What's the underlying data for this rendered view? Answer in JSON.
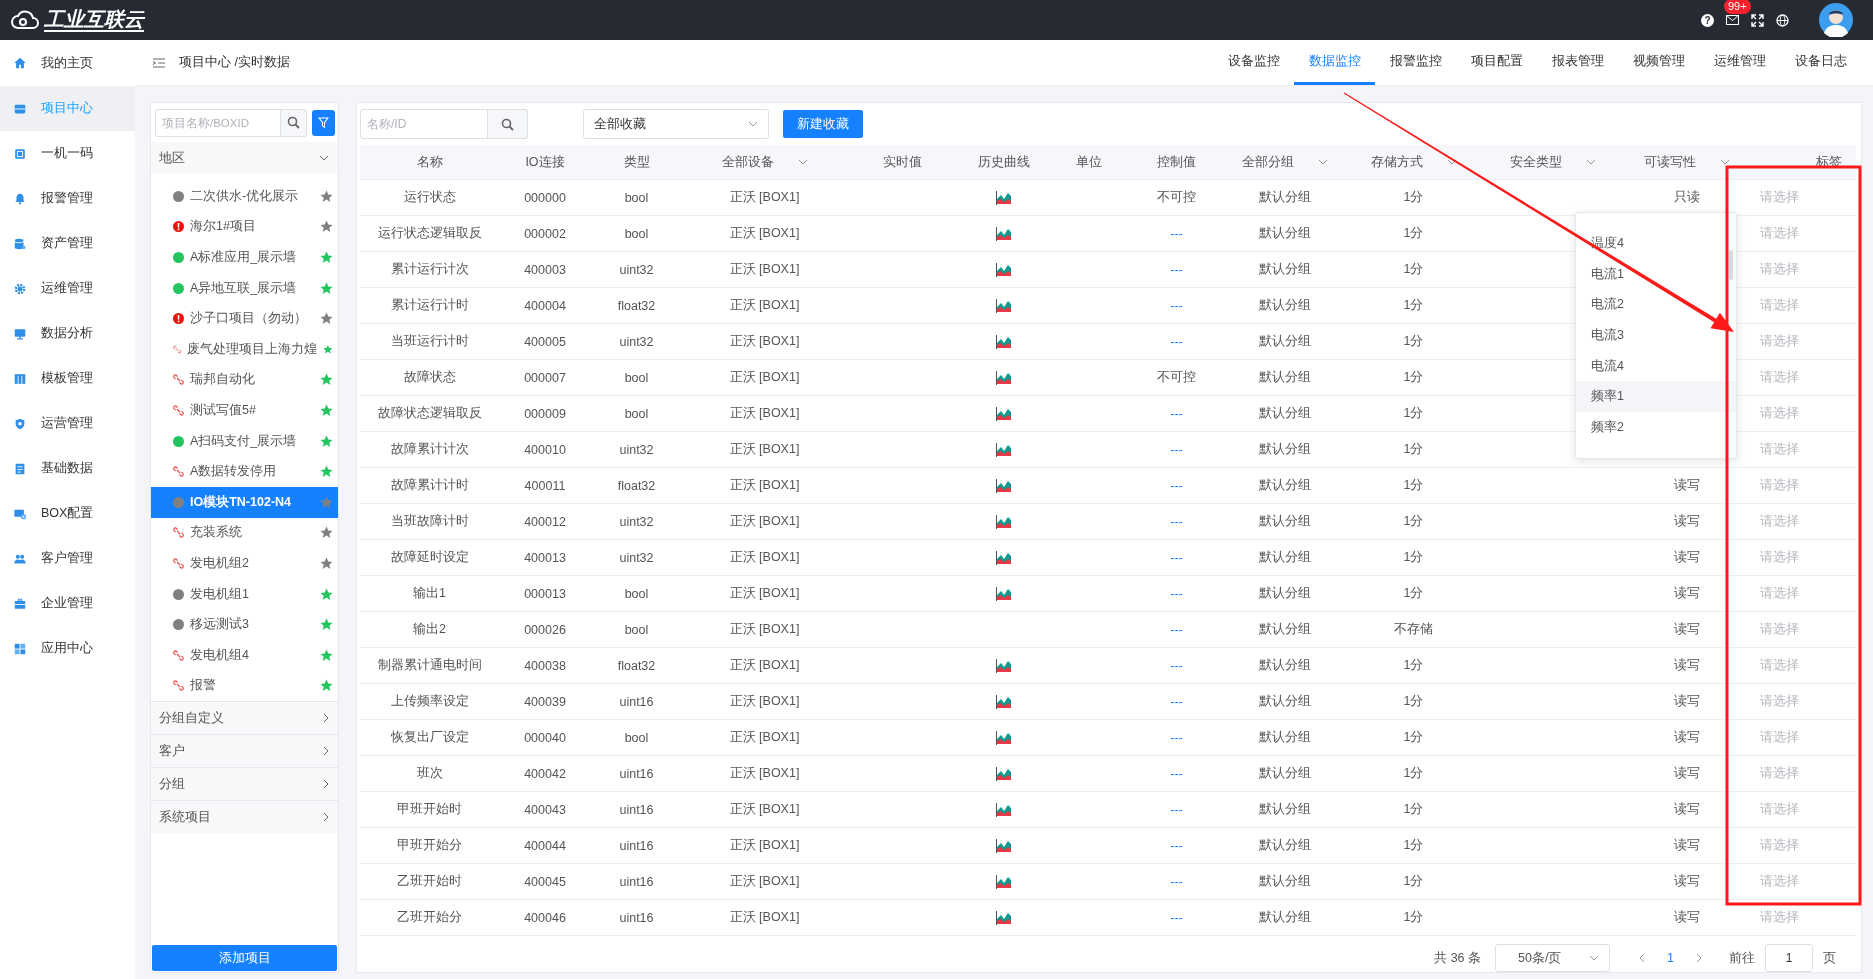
{
  "app": {
    "logo_text": "工业互联云"
  },
  "header_icons": {
    "help_glyph": "?",
    "mail_badge": "99+"
  },
  "nav": {
    "home": "我的主页",
    "items": [
      {
        "label": "项目中心",
        "selected": true
      },
      {
        "label": "一机一码",
        "selected": false
      },
      {
        "label": "报警管理",
        "selected": false
      },
      {
        "label": "资产管理",
        "selected": false
      },
      {
        "label": "运维管理",
        "selected": false
      },
      {
        "label": "数据分析",
        "selected": false
      },
      {
        "label": "模板管理",
        "selected": false
      },
      {
        "label": "运营管理",
        "selected": false
      },
      {
        "label": "基础数据",
        "selected": false
      },
      {
        "label": "BOX配置",
        "selected": false
      },
      {
        "label": "客户管理",
        "selected": false
      },
      {
        "label": "企业管理",
        "selected": false
      },
      {
        "label": "应用中心",
        "selected": false
      }
    ]
  },
  "breadcrumb": "项目中心 /实时数据",
  "tabs": [
    {
      "label": "设备监控",
      "selected": false
    },
    {
      "label": "数据监控",
      "selected": true
    },
    {
      "label": "报警监控",
      "selected": false
    },
    {
      "label": "项目配置",
      "selected": false
    },
    {
      "label": "报表管理",
      "selected": false
    },
    {
      "label": "视频管理",
      "selected": false
    },
    {
      "label": "运维管理",
      "selected": false
    },
    {
      "label": "设备日志",
      "selected": false
    }
  ],
  "project_panel": {
    "search_placeholder": "项目名称/BOXID",
    "region": {
      "label": "地区",
      "expanded": true,
      "items": [
        {
          "label": "二次供水-优化展示",
          "kind": "offline",
          "starred": false,
          "selected": false
        },
        {
          "label": "海尔1#项目",
          "kind": "alarm",
          "starred": false,
          "selected": false
        },
        {
          "label": "A标准应用_展示墙",
          "kind": "online",
          "starred": true,
          "selected": false
        },
        {
          "label": "A异地互联_展示墙",
          "kind": "online",
          "starred": true,
          "selected": false
        },
        {
          "label": "沙子口项目（勿动）",
          "kind": "alarm",
          "starred": false,
          "selected": false
        },
        {
          "label": "废气处理项目上海力煌",
          "kind": "unlinked",
          "starred": true,
          "selected": false
        },
        {
          "label": "瑞邦自动化",
          "kind": "unlinked",
          "starred": true,
          "selected": false
        },
        {
          "label": "测试写值5#",
          "kind": "unlinked",
          "starred": true,
          "selected": false
        },
        {
          "label": "A扫码支付_展示墙",
          "kind": "online",
          "starred": true,
          "selected": false
        },
        {
          "label": "A数据转发停用",
          "kind": "unlinked",
          "starred": true,
          "selected": false
        },
        {
          "label": "IO模块TN-102-N4",
          "kind": "offline",
          "starred": false,
          "selected": true
        },
        {
          "label": "充装系统",
          "kind": "unlinked",
          "starred": false,
          "selected": false
        },
        {
          "label": "发电机组2",
          "kind": "unlinked",
          "starred": false,
          "selected": false
        },
        {
          "label": "发电机组1",
          "kind": "offline",
          "starred": true,
          "selected": false
        },
        {
          "label": "移远测试3",
          "kind": "offline",
          "starred": true,
          "selected": false
        },
        {
          "label": "发电机组4",
          "kind": "unlinked",
          "starred": true,
          "selected": false
        },
        {
          "label": "报警",
          "kind": "unlinked",
          "starred": true,
          "selected": false
        }
      ]
    },
    "groups": [
      {
        "label": "分组自定义",
        "expanded": false
      },
      {
        "label": "客户",
        "expanded": false
      },
      {
        "label": "分组",
        "expanded": false
      },
      {
        "label": "系统项目",
        "expanded": false
      }
    ],
    "add_button": "添加项目"
  },
  "toolbar": {
    "search_placeholder": "名称/ID",
    "favorites_select": "全部收藏",
    "new_button": "新建收藏"
  },
  "table": {
    "columns": [
      {
        "label": "名称",
        "filter": false
      },
      {
        "label": "IO连接",
        "filter": false
      },
      {
        "label": "类型",
        "filter": false
      },
      {
        "label": "全部设备",
        "filter": true
      },
      {
        "label": "实时值",
        "filter": false
      },
      {
        "label": "历史曲线",
        "filter": false
      },
      {
        "label": "单位",
        "filter": false
      },
      {
        "label": "控制值",
        "filter": false
      },
      {
        "label": "全部分组",
        "filter": true
      },
      {
        "label": "存储方式",
        "filter": true
      },
      {
        "label": "安全类型",
        "filter": true
      },
      {
        "label": "可读写性",
        "filter": true
      },
      {
        "label": "标签",
        "filter": false
      }
    ],
    "rows": [
      {
        "name": "运行状态",
        "io": "000000",
        "type": "bool",
        "device": "正沃 [BOX1]",
        "history": true,
        "control": "不可控",
        "control_link": false,
        "group": "默认分组",
        "storage": "1分",
        "access": "只读",
        "tag_placeholder": "请选择"
      },
      {
        "name": "运行状态逻辑取反",
        "io": "000002",
        "type": "bool",
        "device": "正沃 [BOX1]",
        "history": true,
        "control": "---",
        "control_link": true,
        "group": "默认分组",
        "storage": "1分",
        "tag_placeholder": "请选择"
      },
      {
        "name": "累计运行计次",
        "io": "400003",
        "type": "uint32",
        "device": "正沃 [BOX1]",
        "history": true,
        "control": "---",
        "control_link": true,
        "group": "默认分组",
        "storage": "1分",
        "tag_placeholder": "请选择"
      },
      {
        "name": "累计运行计时",
        "io": "400004",
        "type": "float32",
        "device": "正沃 [BOX1]",
        "history": true,
        "control": "---",
        "control_link": true,
        "group": "默认分组",
        "storage": "1分",
        "tag_placeholder": "请选择"
      },
      {
        "name": "当班运行计时",
        "io": "400005",
        "type": "uint32",
        "device": "正沃 [BOX1]",
        "history": true,
        "control": "---",
        "control_link": true,
        "group": "默认分组",
        "storage": "1分",
        "tag_placeholder": "请选择"
      },
      {
        "name": "故障状态",
        "io": "000007",
        "type": "bool",
        "device": "正沃 [BOX1]",
        "history": true,
        "control": "不可控",
        "control_link": false,
        "group": "默认分组",
        "storage": "1分",
        "tag_placeholder": "请选择"
      },
      {
        "name": "故障状态逻辑取反",
        "io": "000009",
        "type": "bool",
        "device": "正沃 [BOX1]",
        "history": true,
        "control": "---",
        "control_link": true,
        "group": "默认分组",
        "storage": "1分",
        "tag_placeholder": "请选择"
      },
      {
        "name": "故障累计计次",
        "io": "400010",
        "type": "uint32",
        "device": "正沃 [BOX1]",
        "history": true,
        "control": "---",
        "control_link": true,
        "group": "默认分组",
        "storage": "1分",
        "tag_placeholder": "请选择"
      },
      {
        "name": "故障累计计时",
        "io": "400011",
        "type": "float32",
        "device": "正沃 [BOX1]",
        "history": true,
        "control": "---",
        "control_link": true,
        "group": "默认分组",
        "storage": "1分",
        "access": "读写",
        "tag_placeholder": "请选择"
      },
      {
        "name": "当班故障计时",
        "io": "400012",
        "type": "uint32",
        "device": "正沃 [BOX1]",
        "history": true,
        "control": "---",
        "control_link": true,
        "group": "默认分组",
        "storage": "1分",
        "access": "读写",
        "tag_placeholder": "请选择"
      },
      {
        "name": "故障延时设定",
        "io": "400013",
        "type": "uint32",
        "device": "正沃 [BOX1]",
        "history": true,
        "control": "---",
        "control_link": true,
        "group": "默认分组",
        "storage": "1分",
        "access": "读写",
        "tag_placeholder": "请选择"
      },
      {
        "name": "输出1",
        "io": "000013",
        "type": "bool",
        "device": "正沃 [BOX1]",
        "history": true,
        "control": "---",
        "control_link": true,
        "group": "默认分组",
        "storage": "1分",
        "access": "读写",
        "tag_placeholder": "请选择"
      },
      {
        "name": "输出2",
        "io": "000026",
        "type": "bool",
        "device": "正沃 [BOX1]",
        "history": false,
        "control": "---",
        "control_link": true,
        "group": "默认分组",
        "storage": "不存储",
        "access": "读写",
        "tag_placeholder": "请选择"
      },
      {
        "name": "制器累计通电时间",
        "io": "400038",
        "type": "float32",
        "device": "正沃 [BOX1]",
        "history": true,
        "control": "---",
        "control_link": true,
        "group": "默认分组",
        "storage": "1分",
        "access": "读写",
        "tag_placeholder": "请选择"
      },
      {
        "name": "上传频率设定",
        "io": "400039",
        "type": "uint16",
        "device": "正沃 [BOX1]",
        "history": true,
        "control": "---",
        "control_link": true,
        "group": "默认分组",
        "storage": "1分",
        "access": "读写",
        "tag_placeholder": "请选择"
      },
      {
        "name": "恢复出厂设定",
        "io": "000040",
        "type": "bool",
        "device": "正沃 [BOX1]",
        "history": true,
        "control": "---",
        "control_link": true,
        "group": "默认分组",
        "storage": "1分",
        "access": "读写",
        "tag_placeholder": "请选择"
      },
      {
        "name": "班次",
        "io": "400042",
        "type": "uint16",
        "device": "正沃 [BOX1]",
        "history": true,
        "control": "---",
        "control_link": true,
        "group": "默认分组",
        "storage": "1分",
        "access": "读写",
        "tag_placeholder": "请选择"
      },
      {
        "name": "甲班开始时",
        "io": "400043",
        "type": "uint16",
        "device": "正沃 [BOX1]",
        "history": true,
        "control": "---",
        "control_link": true,
        "group": "默认分组",
        "storage": "1分",
        "access": "读写",
        "tag_placeholder": "请选择"
      },
      {
        "name": "甲班开始分",
        "io": "400044",
        "type": "uint16",
        "device": "正沃 [BOX1]",
        "history": true,
        "control": "---",
        "control_link": true,
        "group": "默认分组",
        "storage": "1分",
        "access": "读写",
        "tag_placeholder": "请选择"
      },
      {
        "name": "乙班开始时",
        "io": "400045",
        "type": "uint16",
        "device": "正沃 [BOX1]",
        "history": true,
        "control": "---",
        "control_link": true,
        "group": "默认分组",
        "storage": "1分",
        "access": "读写",
        "tag_placeholder": "请选择"
      },
      {
        "name": "乙班开始分",
        "io": "400046",
        "type": "uint16",
        "device": "正沃 [BOX1]",
        "history": true,
        "control": "---",
        "control_link": true,
        "group": "默认分组",
        "storage": "1分",
        "access": "读写",
        "tag_placeholder": "请选择"
      }
    ]
  },
  "tag_dropdown": {
    "options": [
      {
        "label": "温度4",
        "highlighted": false
      },
      {
        "label": "电流1",
        "highlighted": false
      },
      {
        "label": "电流2",
        "highlighted": false
      },
      {
        "label": "电流3",
        "highlighted": false
      },
      {
        "label": "电流4",
        "highlighted": false
      },
      {
        "label": "频率1",
        "highlighted": true
      },
      {
        "label": "频率2",
        "highlighted": false
      }
    ]
  },
  "pagination": {
    "total": "共 36 条",
    "page_size": "50条/页",
    "pages": [
      {
        "label": "1",
        "selected": true
      }
    ],
    "goto_label": "前往",
    "goto_value": "1",
    "page_suffix": "页"
  }
}
